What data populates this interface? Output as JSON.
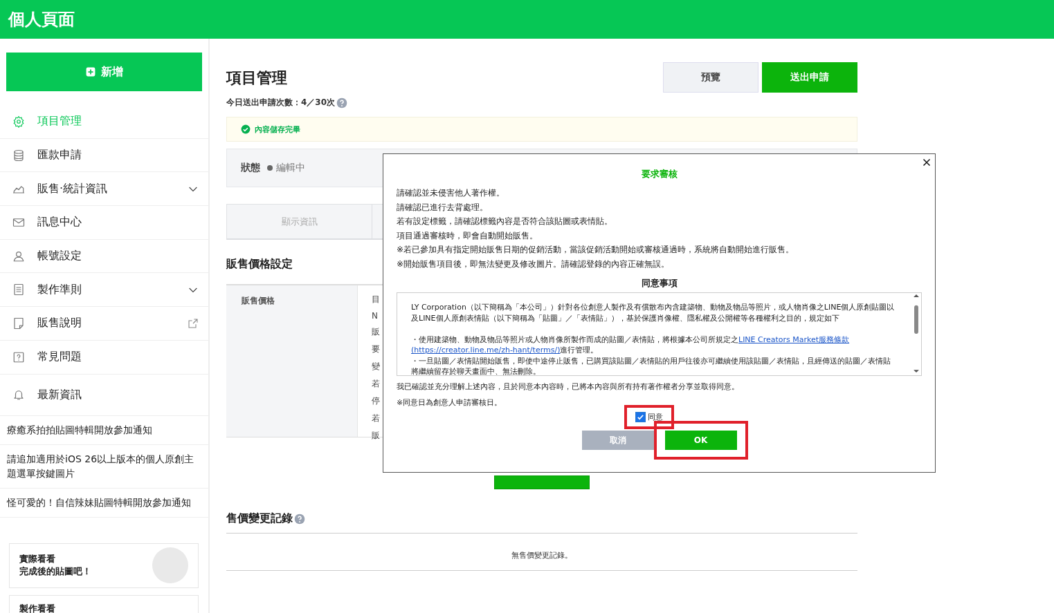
{
  "header": {
    "title": "個人頁面"
  },
  "sidebar": {
    "new_button": "新增",
    "items": [
      {
        "label": "項目管理",
        "selected": true,
        "kind": "plain"
      },
      {
        "label": "匯款申請",
        "selected": false,
        "kind": "plain"
      },
      {
        "label": "販售‧統計資訊",
        "selected": false,
        "kind": "menu",
        "expanded": false
      },
      {
        "label": "訊息中心",
        "selected": false,
        "kind": "plain"
      },
      {
        "label": "帳號設定",
        "selected": false,
        "kind": "plain"
      },
      {
        "label": "製作準則",
        "selected": false,
        "kind": "menu",
        "expanded": false
      },
      {
        "label": "販售說明",
        "selected": false,
        "kind": "external"
      },
      {
        "label": "常見問題",
        "selected": false,
        "kind": "plain"
      }
    ],
    "news_heading": "最新資訊",
    "news": [
      "療癒系拍拍貼圖特輯開放參加通知",
      "請追加適用於iOS 26以上版本的個人原創主題選單按鍵圖片",
      "怪可愛的！自信辣妹貼圖特輯開放參加通知"
    ],
    "cards": [
      {
        "lines": [
          "實際看看",
          "完成後的貼圖吧！"
        ]
      },
      {
        "lines": [
          "製作看看"
        ]
      }
    ]
  },
  "main": {
    "title": "項目管理",
    "quota": "今日送出申請次數：4／30次",
    "buttons": {
      "preview": "預覽",
      "submit": "送出申請"
    },
    "notice": "內容儲存完畢",
    "status": {
      "label": "狀態",
      "value": "編輯中"
    },
    "tabs": [
      {
        "label": "顯示資訊",
        "selected": false
      }
    ],
    "price_section": {
      "title": "販售價格設定",
      "label": "販售價格",
      "fragments": [
        "目",
        "N",
        "販",
        "要",
        "變",
        "若",
        "停",
        "若",
        "販"
      ]
    },
    "history": {
      "title": "售價變更記錄",
      "empty": "無售價變更記錄。"
    }
  },
  "modal": {
    "title": "要求審核",
    "lines": [
      "請確認並未侵害他人著作權。",
      "請確認已進行去背處理。",
      "若有設定標籤，請確認標籤內容是否符合該貼圖或表情貼。",
      "項目通過審核時，即會自動開始販售。",
      "※若已參加具有指定開始販售日期的促銷活動，當該促銷活動開始或審核通過時，系統將自動開始進行販售。",
      "※開始販售項目後，即無法變更及修改圖片。請確認登錄的內容正確無誤。"
    ],
    "agreement_title": "同意事項",
    "terms": {
      "intro": "LY Corporation（以下簡稱為「本公司」）針對各位創意人製作及有償散布內含建築物、動物及物品等照片，或人物肖像之LINE個人原創貼圖以及LINE個人原創表情貼（以下簡稱為「貼圖」／「表情貼」），基於保護肖像權、隱私權及公開權等各種權利之目的，規定如下",
      "bullet1_before": "・使用建築物、動物及物品等照片或人物肖像所製作而成的貼圖／表情貼，將根據本公司所規定之",
      "bullet1_link": "LINE Creators Market服務條款",
      "bullet1_url": "(https://creator.line.me/zh-hant/terms/)",
      "bullet1_after": "進行管理。",
      "bullet2": "・一旦貼圖／表情貼開始販售，即使中途停止販售，已購買該貼圖／表情貼的用戶往後亦可繼續使用該貼圖／表情貼，且經傳送的貼圖／表情貼將繼續留存於聊天畫面中、無法刪除。"
    },
    "confirm": "我已確認並充分理解上述內容，且於同意本內容時，已將本內容與所有持有著作權者分享並取得同意。",
    "note": "※同意日為創意人申請審核日。",
    "checkbox": {
      "label": "同意",
      "checked": true
    },
    "cancel": "取消",
    "ok": "OK"
  }
}
